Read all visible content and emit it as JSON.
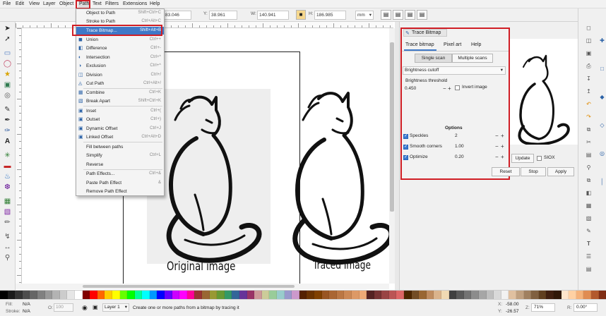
{
  "menubar": {
    "items": [
      "File",
      "Edit",
      "View",
      "Layer",
      "Object",
      "Path",
      "Text",
      "Filters",
      "Extensions",
      "Help"
    ]
  },
  "toolbar": {
    "x_label": "X:",
    "x_value": "83.046",
    "y_label": "Y:",
    "y_value": "38.961",
    "w_label": "W:",
    "w_value": "140.941",
    "h_label": "H:",
    "h_value": "186.985",
    "unit": "mm"
  },
  "path_menu": {
    "items": [
      {
        "label": "Object to Path",
        "shortcut": "Shift+Ctrl+C"
      },
      {
        "label": "Stroke to Path",
        "shortcut": "Ctrl+Alt+C"
      },
      {
        "label": "Trace Bitmap...",
        "shortcut": "Shift+Alt+B"
      },
      {
        "label": "Union",
        "shortcut": "Ctrl++"
      },
      {
        "label": "Difference",
        "shortcut": "Ctrl+-"
      },
      {
        "label": "Intersection",
        "shortcut": "Ctrl+*"
      },
      {
        "label": "Exclusion",
        "shortcut": "Ctrl+^"
      },
      {
        "label": "Division",
        "shortcut": "Ctrl+/"
      },
      {
        "label": "Cut Path",
        "shortcut": "Ctrl+Alt+/"
      },
      {
        "label": "Combine",
        "shortcut": "Ctrl+K"
      },
      {
        "label": "Break Apart",
        "shortcut": "Shift+Ctrl+K"
      },
      {
        "label": "Inset",
        "shortcut": "Ctrl+("
      },
      {
        "label": "Outset",
        "shortcut": "Ctrl+)"
      },
      {
        "label": "Dynamic Offset",
        "shortcut": "Ctrl+J"
      },
      {
        "label": "Linked Offset",
        "shortcut": "Ctrl+Alt+D"
      },
      {
        "label": "Fill between paths",
        "shortcut": ""
      },
      {
        "label": "Simplify",
        "shortcut": "Ctrl+L"
      },
      {
        "label": "Reverse",
        "shortcut": ""
      },
      {
        "label": "Path Effects...",
        "shortcut": "Ctrl+&"
      },
      {
        "label": "Paste Path Effect",
        "shortcut": "&"
      },
      {
        "label": "Remove Path Effect",
        "shortcut": ""
      }
    ]
  },
  "trace_panel": {
    "title": "Trace Bitmap",
    "tabs": [
      "Trace bitmap",
      "Pixel art",
      "Help"
    ],
    "scan_modes": [
      "Single scan",
      "Multiple scans"
    ],
    "mode_select": "Brightness cutoff",
    "threshold_label": "Brightness threshold",
    "threshold_value": "0.450",
    "invert_label": "Invert image",
    "options_title": "Options",
    "speckles_label": "Speckles",
    "speckles_value": "2",
    "smooth_label": "Smooth corners",
    "smooth_value": "1.00",
    "optimize_label": "Optimize",
    "optimize_value": "0.20"
  },
  "dock_buttons": {
    "update": "Update",
    "siox": "SIOX",
    "reset": "Reset",
    "stop": "Stop",
    "apply": "Apply"
  },
  "canvas": {
    "caption_original": "Original image",
    "caption_traced": "Traced Image"
  },
  "statusbar": {
    "fill_label": "Fill:",
    "fill_value": "N/A",
    "stroke_label": "Stroke:",
    "stroke_value": "N/A",
    "opacity_label": "O:",
    "opacity_value": "100",
    "layer": "Layer 1",
    "message": "Create one or more paths from a bitmap by tracing it",
    "x_label": "X:",
    "x_value": "-58.00",
    "y_label": "Y:",
    "y_value": "-26.57",
    "zoom_label": "Z:",
    "zoom_value": "71%",
    "rotation_label": "R:",
    "rotation_value": "0.00°"
  },
  "palette_colors": [
    "#000000",
    "#1a1a1a",
    "#333333",
    "#4d4d4d",
    "#666666",
    "#808080",
    "#999999",
    "#b3b3b3",
    "#cccccc",
    "#e6e6e6",
    "#ffffff",
    "#800000",
    "#ff0000",
    "#ff6600",
    "#ffcc00",
    "#ffff00",
    "#66ff00",
    "#00ff00",
    "#00ff99",
    "#00ffff",
    "#0099ff",
    "#0000ff",
    "#6600ff",
    "#cc00ff",
    "#ff00ff",
    "#ff0099",
    "#993333",
    "#996633",
    "#999933",
    "#669933",
    "#339966",
    "#336699",
    "#663399",
    "#993366",
    "#cc9999",
    "#cccc99",
    "#99cc99",
    "#99cccc",
    "#9999cc",
    "#cc99cc",
    "#552200",
    "#6b3300",
    "#804000",
    "#995522",
    "#aa6633",
    "#bb7744",
    "#cc8855",
    "#dd9966",
    "#eeaa77",
    "#552222",
    "#773333",
    "#994444",
    "#bb5555",
    "#dd6666",
    "#4d2600",
    "#734d26",
    "#996633",
    "#bf8c60",
    "#dab38c",
    "#f0d9b3",
    "#404040",
    "#595959",
    "#737373",
    "#8c8c8c",
    "#a6a6a6",
    "#bfbfbf",
    "#d9d9d9",
    "#f2f2f2",
    "#e0c0a0",
    "#c0a080",
    "#a08060",
    "#806040",
    "#604020",
    "#402010",
    "#301808",
    "#ffe6cc",
    "#ffd1a3",
    "#f5b27a",
    "#e08c52",
    "#b3592d",
    "#802d14"
  ]
}
